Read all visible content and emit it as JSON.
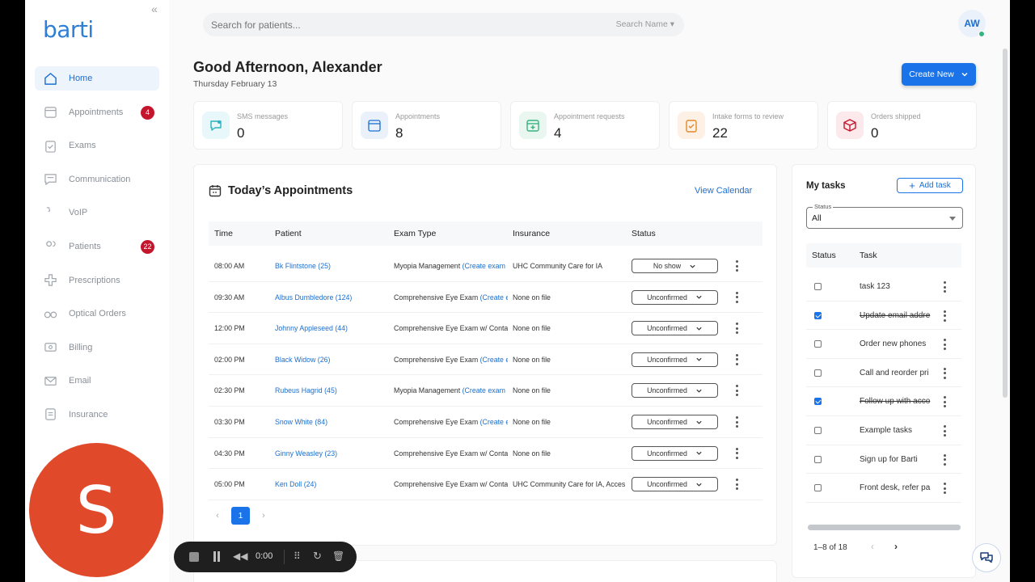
{
  "brand": {
    "logo": "barti",
    "collapse_glyph": "«"
  },
  "sidebar": {
    "items": [
      {
        "label": "Home",
        "icon": "home-icon",
        "badge": null,
        "active": true
      },
      {
        "label": "Appointments",
        "icon": "calendar-icon",
        "badge": "4"
      },
      {
        "label": "Exams",
        "icon": "clipboard-icon",
        "badge": null
      },
      {
        "label": "Communication",
        "icon": "chat-icon",
        "badge": null
      },
      {
        "label": "VoIP",
        "icon": "phone-icon",
        "badge": null
      },
      {
        "label": "Patients",
        "icon": "users-icon",
        "badge": "22"
      },
      {
        "label": "Prescriptions",
        "icon": "prescription-icon",
        "badge": null
      },
      {
        "label": "Optical Orders",
        "icon": "glasses-icon",
        "badge": null
      },
      {
        "label": "Billing",
        "icon": "billing-icon",
        "badge": null
      },
      {
        "label": "Email",
        "icon": "mail-icon",
        "badge": null
      },
      {
        "label": "Insurance",
        "icon": "insurance-icon",
        "badge": null
      }
    ]
  },
  "search": {
    "placeholder": "Search for patients...",
    "filter": "Search Name"
  },
  "user": {
    "initials": "AW"
  },
  "header": {
    "greeting": "Good Afternoon, Alexander",
    "date": "Thursday February 13",
    "create_label": "Create New"
  },
  "stats": [
    {
      "label": "SMS messages",
      "value": "0",
      "icon": "sms-icon",
      "color": "#2bb3c0",
      "bg": "#e8f7f9"
    },
    {
      "label": "Appointments",
      "value": "8",
      "icon": "calendar-icon",
      "color": "#1a6fd1",
      "bg": "#eaf1fb"
    },
    {
      "label": "Appointment requests",
      "value": "4",
      "icon": "calendar-add-icon",
      "color": "#36b37e",
      "bg": "#e9f7f0"
    },
    {
      "label": "Intake forms to review",
      "value": "22",
      "icon": "clipboard-check-icon",
      "color": "#e0892b",
      "bg": "#fdf1e6"
    },
    {
      "label": "Orders shipped",
      "value": "0",
      "icon": "package-icon",
      "color": "#c4152c",
      "bg": "#fbe9eb"
    }
  ],
  "appointments": {
    "title": "Today’s Appointments",
    "view_calendar": "View Calendar",
    "columns": [
      "Time",
      "Patient",
      "Exam Type",
      "Insurance",
      "Status"
    ],
    "rows": [
      {
        "time": "08:00 AM",
        "patient": "Bk Flintstone (25)",
        "exam": "Myopia Management",
        "exam_link": "(Create exam",
        "insurance": "UHC Community Care for IA",
        "status": "No show"
      },
      {
        "time": "09:30 AM",
        "patient": "Albus Dumbledore (124)",
        "exam": "Comprehensive Eye Exam",
        "exam_link": "(Create e",
        "insurance": "None on file",
        "status": "Unconfirmed"
      },
      {
        "time": "12:00 PM",
        "patient": "Johnny Appleseed (44)",
        "exam": "Comprehensive Eye Exam w/ Conta",
        "exam_link": "",
        "insurance": "None on file",
        "status": "Unconfirmed"
      },
      {
        "time": "02:00 PM",
        "patient": "Black Widow (26)",
        "exam": "Comprehensive Eye Exam",
        "exam_link": "(Create e",
        "insurance": "None on file",
        "status": "Unconfirmed"
      },
      {
        "time": "02:30 PM",
        "patient": "Rubeus Hagrid (45)",
        "exam": "Myopia Management",
        "exam_link": "(Create exam",
        "insurance": "None on file",
        "status": "Unconfirmed"
      },
      {
        "time": "03:30 PM",
        "patient": "Snow White (84)",
        "exam": "Comprehensive Eye Exam",
        "exam_link": "(Create e",
        "insurance": "None on file",
        "status": "Unconfirmed"
      },
      {
        "time": "04:30 PM",
        "patient": "Ginny Weasley (23)",
        "exam": "Comprehensive Eye Exam w/ Conta",
        "exam_link": "",
        "insurance": "None on file",
        "status": "Unconfirmed"
      },
      {
        "time": "05:00 PM",
        "patient": "Ken Doll (24)",
        "exam": "Comprehensive Eye Exam w/ Conta",
        "exam_link": "",
        "insurance": "UHC Community Care for IA, Acces",
        "status": "Unconfirmed"
      }
    ],
    "page": "1"
  },
  "tasks": {
    "title": "My tasks",
    "add_label": "Add task",
    "filter_label": "Status",
    "filter_value": "All",
    "columns": [
      "Status",
      "Task"
    ],
    "items": [
      {
        "text": "task 123",
        "done": false
      },
      {
        "text": "Update email addre",
        "done": true
      },
      {
        "text": "Order new phones",
        "done": false
      },
      {
        "text": "Call and reorder pri",
        "done": false
      },
      {
        "text": "Follow up with acco",
        "done": true
      },
      {
        "text": "Example tasks",
        "done": false
      },
      {
        "text": "Sign up for Barti",
        "done": false
      },
      {
        "text": "Front desk, refer pa",
        "done": false
      }
    ],
    "range": "1–8 of 18"
  },
  "recorder": {
    "avatar_letter": "S",
    "time": "0:00"
  }
}
